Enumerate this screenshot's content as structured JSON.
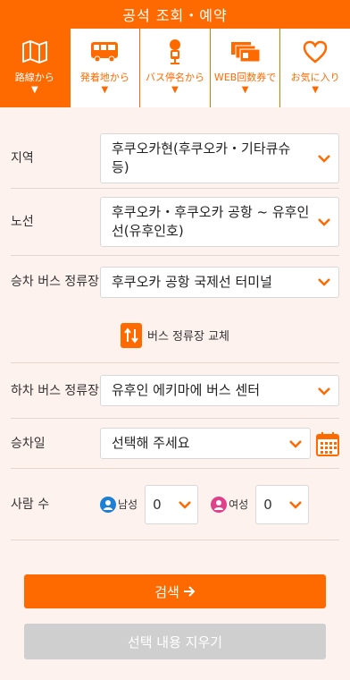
{
  "header": {
    "title": "공석 조회・예약"
  },
  "tabs": [
    {
      "label": "路線から",
      "icon": "map-icon",
      "active": true
    },
    {
      "label": "発着地から",
      "icon": "bus-icon",
      "active": false
    },
    {
      "label": "バス停名から",
      "icon": "bus-stop-icon",
      "active": false
    },
    {
      "label": "WEB回数券で",
      "icon": "tickets-icon",
      "active": false
    },
    {
      "label": "お気に入り",
      "icon": "heart-icon",
      "active": false
    }
  ],
  "form": {
    "region_label": "지역",
    "region_value": "후쿠오카현(후쿠오카・기타큐슈 등)",
    "route_label": "노선",
    "route_value": "후쿠오카・후쿠오카 공항 ~ 유후인선(유후인호)",
    "boarding_label": "승차 버스 정류장",
    "boarding_value": "후쿠오카 공항 국제선 터미널",
    "swap_label": "버스 정류장 교체",
    "alighting_label": "하차 버스 정류장",
    "alighting_value": "유후인 에키마에 버스 센터",
    "date_label": "승차일",
    "date_value": "선택해 주세요",
    "people_label": "사람 수",
    "male_label": "남성",
    "male_value": "0",
    "female_label": "여성",
    "female_value": "0"
  },
  "buttons": {
    "search_label": "검색",
    "clear_label": "선택 내용 지우기"
  },
  "colors": {
    "accent": "#ff6a00",
    "male_icon": "#1e7fd6",
    "female_icon": "#e0408a",
    "clear_button": "#cfcfcf"
  }
}
